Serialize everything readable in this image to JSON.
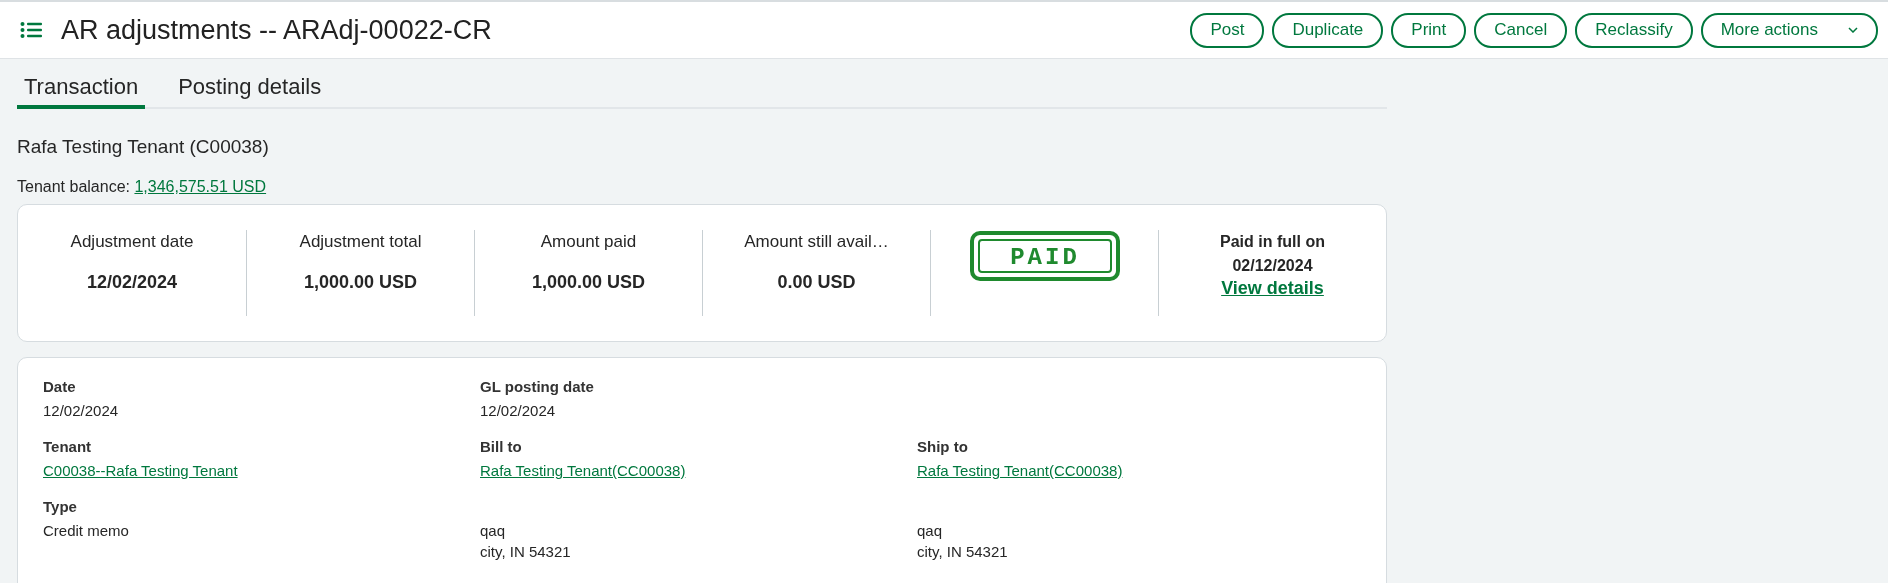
{
  "header": {
    "title": "AR adjustments -- ARAdj-00022-CR",
    "buttons": [
      {
        "label": "Post",
        "kind": "plain"
      },
      {
        "label": "Duplicate",
        "kind": "plain"
      },
      {
        "label": "Print",
        "kind": "plain"
      },
      {
        "label": "Cancel",
        "kind": "plain"
      },
      {
        "label": "Reclassify",
        "kind": "plain"
      },
      {
        "label": "More actions",
        "kind": "dropdown"
      }
    ]
  },
  "tabs": [
    {
      "label": "Transaction",
      "selected": true
    },
    {
      "label": "Posting details",
      "selected": false
    }
  ],
  "tenant_heading": "Rafa Testing Tenant (C00038)",
  "balance": {
    "label": "Tenant balance:",
    "value": "1,346,575.51 USD"
  },
  "summary": {
    "items": [
      {
        "label": "Adjustment date",
        "value": "12/02/2024"
      },
      {
        "label": "Adjustment total",
        "value": "1,000.00 USD"
      },
      {
        "label": "Amount paid",
        "value": "1,000.00 USD"
      },
      {
        "label": "Amount still avail…",
        "value": "0.00 USD"
      }
    ],
    "stamp": "PAID",
    "paid": {
      "label": "Paid in full on",
      "date": "02/12/2024",
      "link": "View details"
    }
  },
  "details": {
    "rows": [
      [
        {
          "kind": "text",
          "label": "Date",
          "value": "12/02/2024"
        },
        {
          "kind": "text",
          "label": "GL posting date",
          "value": "12/02/2024"
        },
        {
          "kind": "empty"
        }
      ],
      [
        {
          "kind": "link",
          "label": "Tenant",
          "value": "C00038--Rafa Testing Tenant"
        },
        {
          "kind": "link",
          "label": "Bill to",
          "value": "Rafa Testing Tenant(CC00038)"
        },
        {
          "kind": "link",
          "label": "Ship to",
          "value": "Rafa Testing Tenant(CC00038)"
        }
      ],
      [
        {
          "kind": "text",
          "label": "Type",
          "value": "Credit memo"
        },
        {
          "kind": "address",
          "lines": [
            "qaq",
            "city, IN 54321"
          ]
        },
        {
          "kind": "address",
          "lines": [
            "qaq",
            "city, IN 54321"
          ]
        }
      ]
    ]
  }
}
